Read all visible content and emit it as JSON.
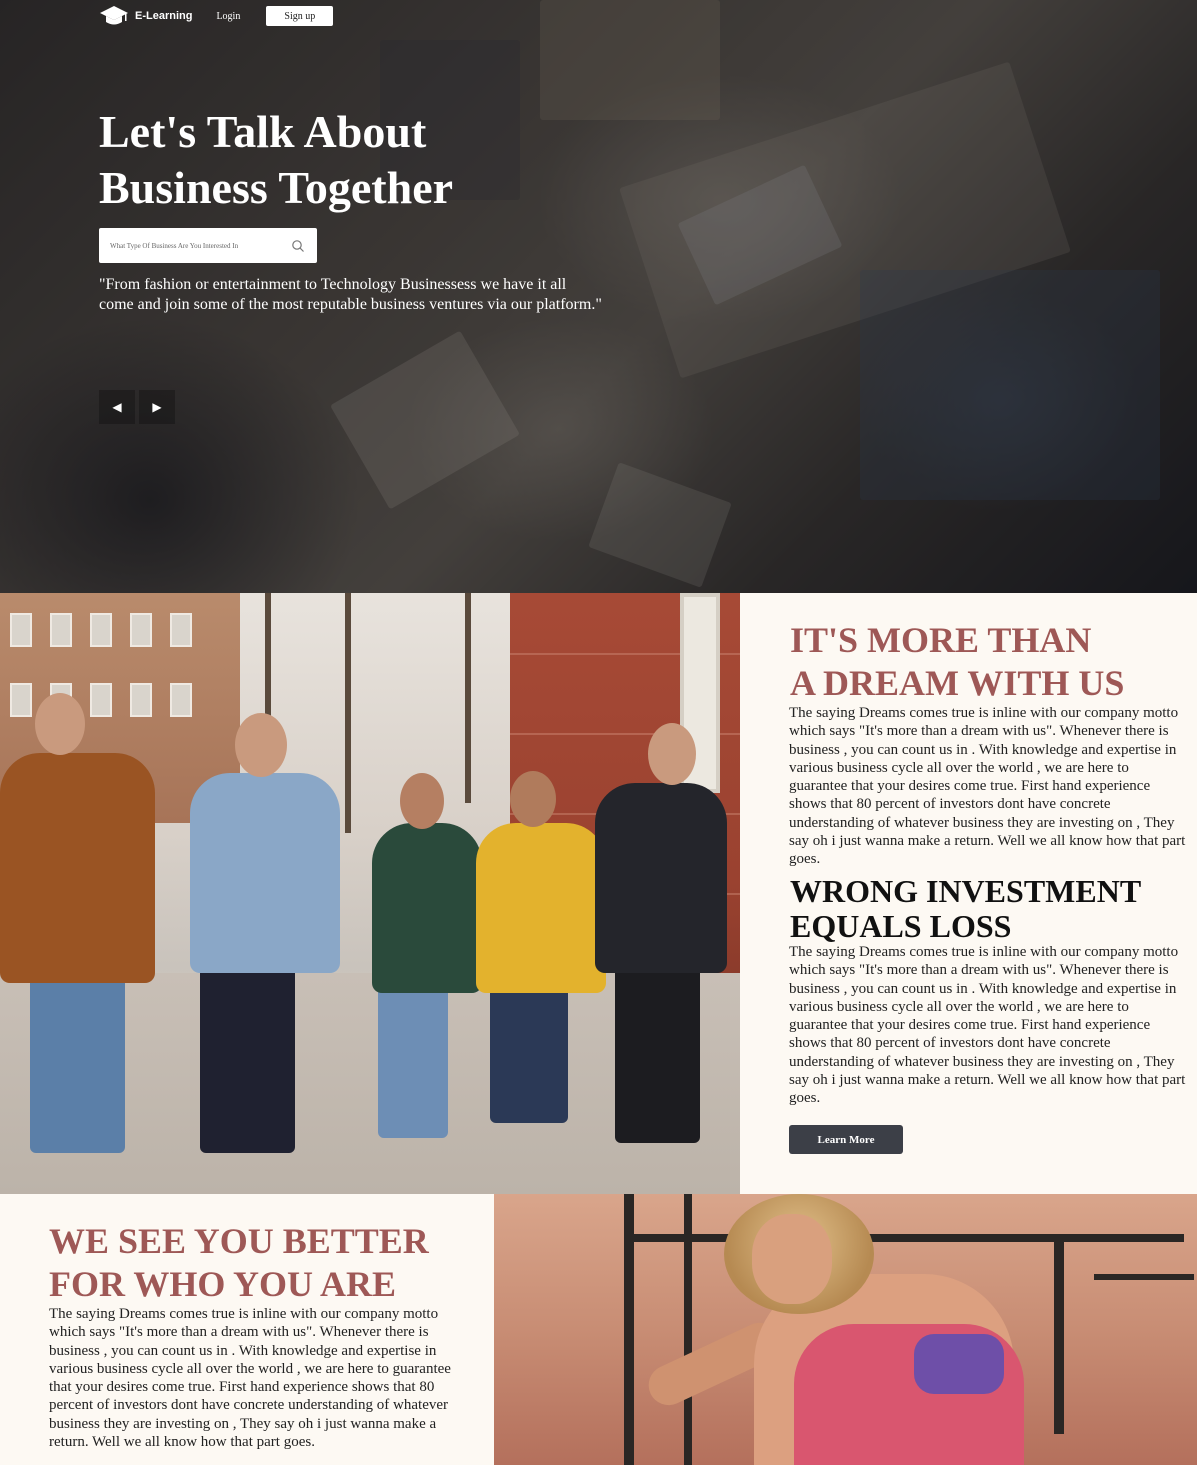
{
  "nav": {
    "logo_text": "E-Learning",
    "login_label": "Login",
    "signup_label": "Sign up"
  },
  "hero": {
    "title_line1": "Let's Talk About",
    "title_line2": "Business Together",
    "search_placeholder": "What Type Of Business Are You Interested In",
    "quote_line1": "\"From fashion or entertainment to Technology Businessess we have it all",
    "quote_line2": "come and join some of the most reputable business ventures via our platform.\"",
    "prev_label": "◀",
    "next_label": "▶"
  },
  "section_dream": {
    "heading_line1": "IT'S MORE THAN",
    "heading_line2": "A DREAM WITH US",
    "paragraph": "The saying Dreams comes true is inline with our company motto which says \"It's more than a dream with us\". Whenever there is business , you can count us in . With knowledge and expertise in various business cycle all over the world , we are here to guarantee that your desires come true. First hand experience shows that 80 percent of investors dont have concrete understanding of whatever business they are investing on , They say oh i just wanna make a return. Well we all know how that part goes.",
    "subheading_line1": "WRONG INVESTMENT",
    "subheading_line2": "EQUALS LOSS",
    "paragraph2": "The saying Dreams comes true is inline with our company motto which says \"It's more than a dream with us\". Whenever there is business , you can count us in . With knowledge and expertise in various business cycle all over the world , we are here to guarantee that your desires come true. First hand experience shows that 80 percent of investors dont have concrete understanding of whatever business they are investing on , They say oh i just wanna make a return. Well we all know how that part goes.",
    "button_label": "Learn More"
  },
  "section_better": {
    "heading_line1": "WE SEE YOU BETTER",
    "heading_line2": "FOR WHO YOU ARE",
    "paragraph": "The saying Dreams comes true is inline with our company motto which says \"It's more than a dream with us\". Whenever there is business , you can count us in . With knowledge and expertise in various business cycle all over the world , we are here to guarantee that your desires come true. First hand experience shows that 80 percent of investors dont have concrete understanding of whatever business they are investing on , They say oh i just wanna make a return. Well we all know how that part goes."
  },
  "colors": {
    "heading_accent": "#9e5856",
    "button_bg": "#3c3f47",
    "card_bg": "#fdf9f3"
  },
  "icons": {
    "logo": "graduation-cap-icon",
    "search": "search-icon",
    "prev": "arrow-left-icon",
    "next": "arrow-right-icon"
  }
}
